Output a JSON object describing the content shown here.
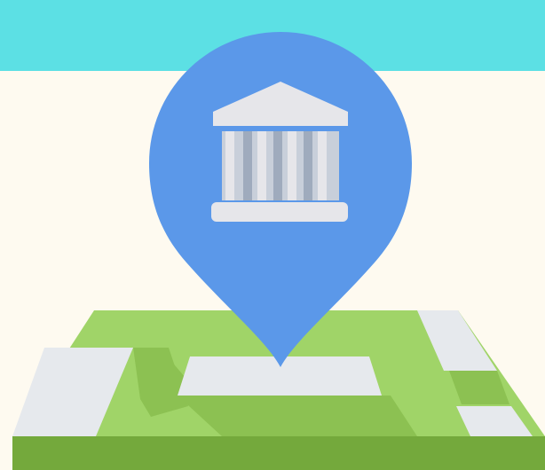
{
  "illustration": {
    "subject": "location-pin-over-map",
    "pin_icon": "bank-building-icon",
    "colors": {
      "top_band": "#5ce0e4",
      "background": "#fefaf0",
      "pin": "#5b98e9",
      "building": "#e6e6ea",
      "building_columns": "#b5bfcf",
      "map_light_green": "#a0d468",
      "map_dark_green": "#8cc152",
      "map_base_green": "#74a93c",
      "map_blocks": "#e6e9ed"
    }
  }
}
